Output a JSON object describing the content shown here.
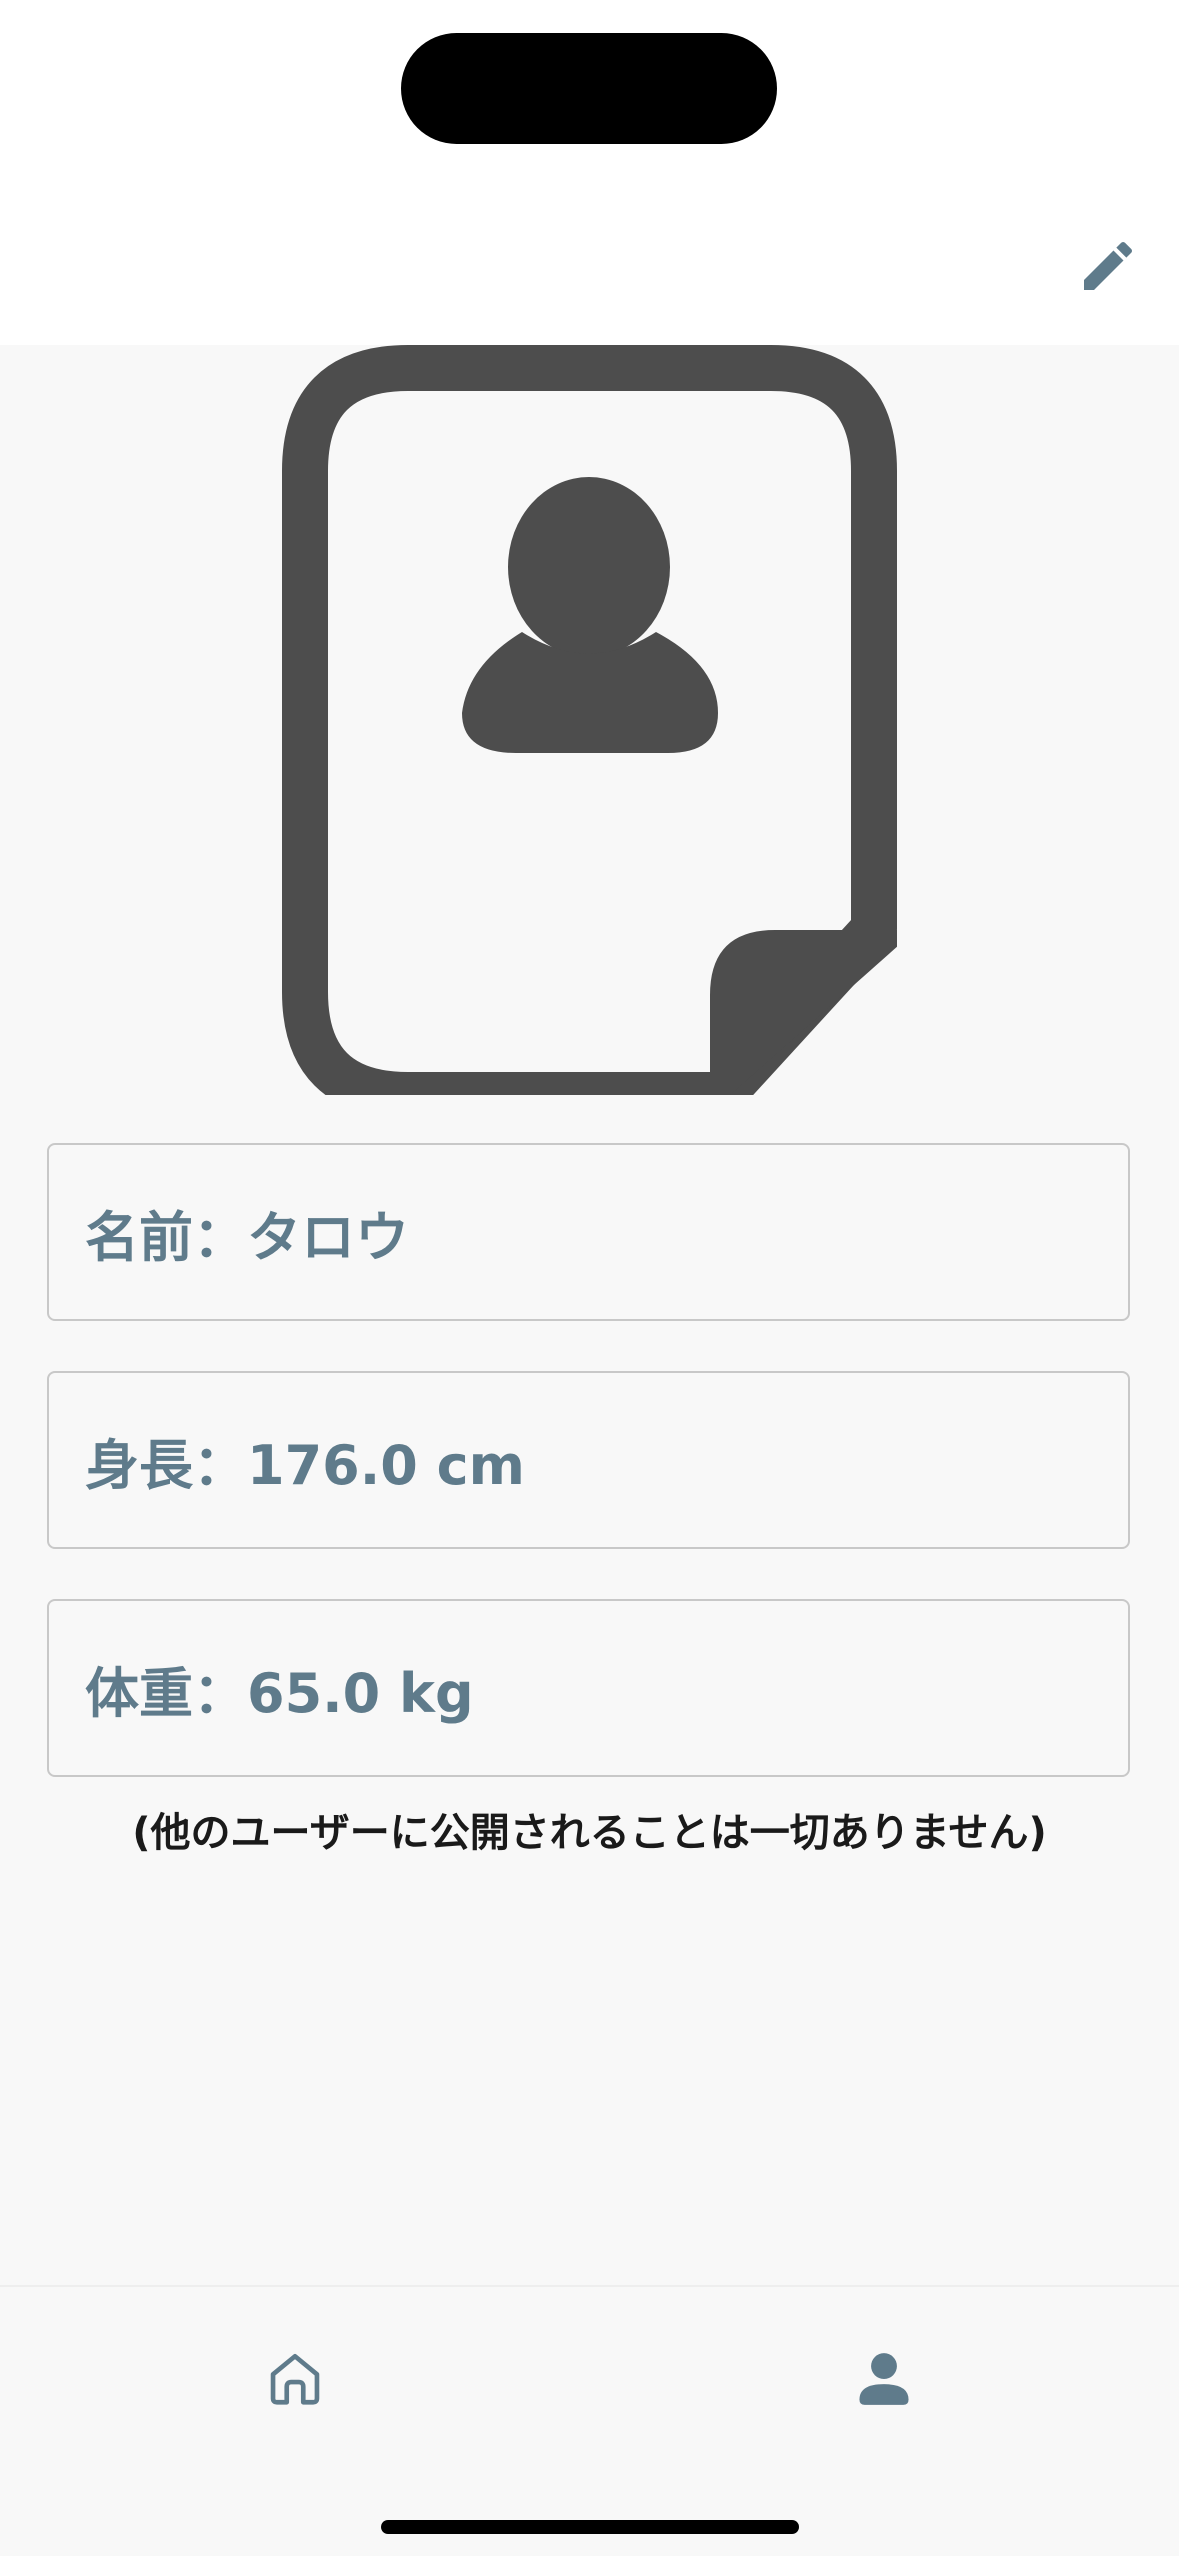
{
  "header": {
    "edit_icon": "pencil-icon"
  },
  "profile": {
    "avatar_icon": "contact-file-icon",
    "name_line": "名前：タロウ",
    "height_line": "身長：176.0 cm",
    "weight_line": "体重：65.0 kg",
    "privacy_note": "(他のユーザーに公開されることは一切ありません)"
  },
  "tab_bar": {
    "tabs": [
      {
        "icon": "home-icon",
        "active": false
      },
      {
        "icon": "person-icon",
        "active": true
      }
    ]
  },
  "colors": {
    "accent": "#5f7b8b",
    "icon_dark": "#4d4d4d",
    "background": "#f8f8f8",
    "header_bg": "#ffffff"
  }
}
